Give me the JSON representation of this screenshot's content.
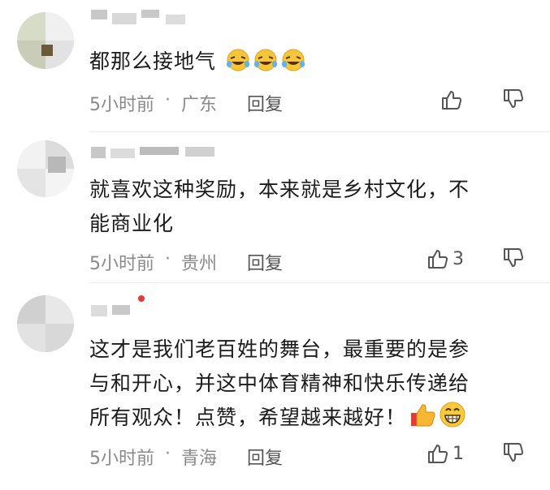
{
  "comments": [
    {
      "text": "都那么接地气",
      "emoji": [
        "rofl-icon",
        "rofl-icon",
        "rofl-icon"
      ],
      "time": "5小时前",
      "separator": "·",
      "location": "广东",
      "reply_label": "回复",
      "like_count": ""
    },
    {
      "text_lines": [
        "就喜欢这种奖励，本来就是乡村文化，不",
        "能商业化"
      ],
      "time": "5小时前",
      "separator": "·",
      "location": "贵州",
      "reply_label": "回复",
      "like_count": "3"
    },
    {
      "text_lines": [
        "这才是我们老百姓的舞台，最重要的是参",
        "与和开心，并这中体育精神和快乐传递给",
        "所有观众！点赞，希望越来越好！"
      ],
      "emoji": [
        "thumbs-up-icon",
        "grin-icon"
      ],
      "time": "5小时前",
      "separator": "·",
      "location": "青海",
      "reply_label": "回复",
      "like_count": "1"
    }
  ],
  "colors": {
    "text": "#1c1c1c",
    "meta": "#8a8a8a",
    "reply": "#555555",
    "notification_dot": "#e53935"
  }
}
